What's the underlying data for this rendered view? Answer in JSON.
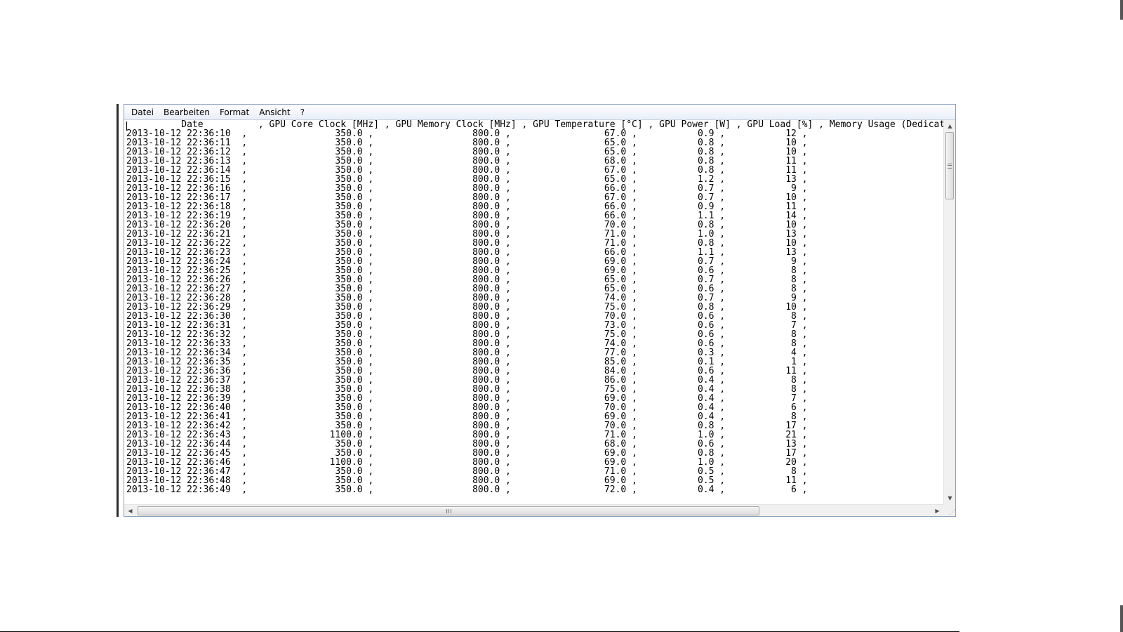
{
  "menu": [
    "Datei",
    "Bearbeiten",
    "Format",
    "Ansicht",
    "?"
  ],
  "header": "          Date          , GPU Core Clock [MHz] , GPU Memory Clock [MHz] , GPU Temperature [°C] , GPU Power [W] , GPU Load [%] , Memory Usage (Dedicat",
  "rows": [
    [
      "2013-10-12 22:36:10",
      "350.0",
      "800.0",
      "67.0",
      "0.9",
      "12"
    ],
    [
      "2013-10-12 22:36:11",
      "350.0",
      "800.0",
      "65.0",
      "0.8",
      "10"
    ],
    [
      "2013-10-12 22:36:12",
      "350.0",
      "800.0",
      "65.0",
      "0.8",
      "10"
    ],
    [
      "2013-10-12 22:36:13",
      "350.0",
      "800.0",
      "68.0",
      "0.8",
      "11"
    ],
    [
      "2013-10-12 22:36:14",
      "350.0",
      "800.0",
      "67.0",
      "0.8",
      "11"
    ],
    [
      "2013-10-12 22:36:15",
      "350.0",
      "800.0",
      "65.0",
      "1.2",
      "13"
    ],
    [
      "2013-10-12 22:36:16",
      "350.0",
      "800.0",
      "66.0",
      "0.7",
      "9"
    ],
    [
      "2013-10-12 22:36:17",
      "350.0",
      "800.0",
      "67.0",
      "0.7",
      "10"
    ],
    [
      "2013-10-12 22:36:18",
      "350.0",
      "800.0",
      "66.0",
      "0.9",
      "11"
    ],
    [
      "2013-10-12 22:36:19",
      "350.0",
      "800.0",
      "66.0",
      "1.1",
      "14"
    ],
    [
      "2013-10-12 22:36:20",
      "350.0",
      "800.0",
      "70.0",
      "0.8",
      "10"
    ],
    [
      "2013-10-12 22:36:21",
      "350.0",
      "800.0",
      "71.0",
      "1.0",
      "13"
    ],
    [
      "2013-10-12 22:36:22",
      "350.0",
      "800.0",
      "71.0",
      "0.8",
      "10"
    ],
    [
      "2013-10-12 22:36:23",
      "350.0",
      "800.0",
      "66.0",
      "1.1",
      "13"
    ],
    [
      "2013-10-12 22:36:24",
      "350.0",
      "800.0",
      "69.0",
      "0.7",
      "9"
    ],
    [
      "2013-10-12 22:36:25",
      "350.0",
      "800.0",
      "69.0",
      "0.6",
      "8"
    ],
    [
      "2013-10-12 22:36:26",
      "350.0",
      "800.0",
      "65.0",
      "0.7",
      "8"
    ],
    [
      "2013-10-12 22:36:27",
      "350.0",
      "800.0",
      "65.0",
      "0.6",
      "8"
    ],
    [
      "2013-10-12 22:36:28",
      "350.0",
      "800.0",
      "74.0",
      "0.7",
      "9"
    ],
    [
      "2013-10-12 22:36:29",
      "350.0",
      "800.0",
      "75.0",
      "0.8",
      "10"
    ],
    [
      "2013-10-12 22:36:30",
      "350.0",
      "800.0",
      "70.0",
      "0.6",
      "8"
    ],
    [
      "2013-10-12 22:36:31",
      "350.0",
      "800.0",
      "73.0",
      "0.6",
      "7"
    ],
    [
      "2013-10-12 22:36:32",
      "350.0",
      "800.0",
      "75.0",
      "0.6",
      "8"
    ],
    [
      "2013-10-12 22:36:33",
      "350.0",
      "800.0",
      "74.0",
      "0.6",
      "8"
    ],
    [
      "2013-10-12 22:36:34",
      "350.0",
      "800.0",
      "77.0",
      "0.3",
      "4"
    ],
    [
      "2013-10-12 22:36:35",
      "350.0",
      "800.0",
      "85.0",
      "0.1",
      "1"
    ],
    [
      "2013-10-12 22:36:36",
      "350.0",
      "800.0",
      "84.0",
      "0.6",
      "11"
    ],
    [
      "2013-10-12 22:36:37",
      "350.0",
      "800.0",
      "86.0",
      "0.4",
      "8"
    ],
    [
      "2013-10-12 22:36:38",
      "350.0",
      "800.0",
      "75.0",
      "0.4",
      "8"
    ],
    [
      "2013-10-12 22:36:39",
      "350.0",
      "800.0",
      "69.0",
      "0.4",
      "7"
    ],
    [
      "2013-10-12 22:36:40",
      "350.0",
      "800.0",
      "70.0",
      "0.4",
      "6"
    ],
    [
      "2013-10-12 22:36:41",
      "350.0",
      "800.0",
      "69.0",
      "0.4",
      "8"
    ],
    [
      "2013-10-12 22:36:42",
      "350.0",
      "800.0",
      "70.0",
      "0.8",
      "17"
    ],
    [
      "2013-10-12 22:36:43",
      "1100.0",
      "800.0",
      "71.0",
      "1.0",
      "21"
    ],
    [
      "2013-10-12 22:36:44",
      "350.0",
      "800.0",
      "68.0",
      "0.6",
      "13"
    ],
    [
      "2013-10-12 22:36:45",
      "350.0",
      "800.0",
      "69.0",
      "0.8",
      "17"
    ],
    [
      "2013-10-12 22:36:46",
      "1100.0",
      "800.0",
      "69.0",
      "1.0",
      "20"
    ],
    [
      "2013-10-12 22:36:47",
      "350.0",
      "800.0",
      "71.0",
      "0.5",
      "8"
    ],
    [
      "2013-10-12 22:36:48",
      "350.0",
      "800.0",
      "69.0",
      "0.5",
      "11"
    ],
    [
      "2013-10-12 22:36:49",
      "350.0",
      "800.0",
      "72.0",
      "0.4",
      "6"
    ]
  ]
}
